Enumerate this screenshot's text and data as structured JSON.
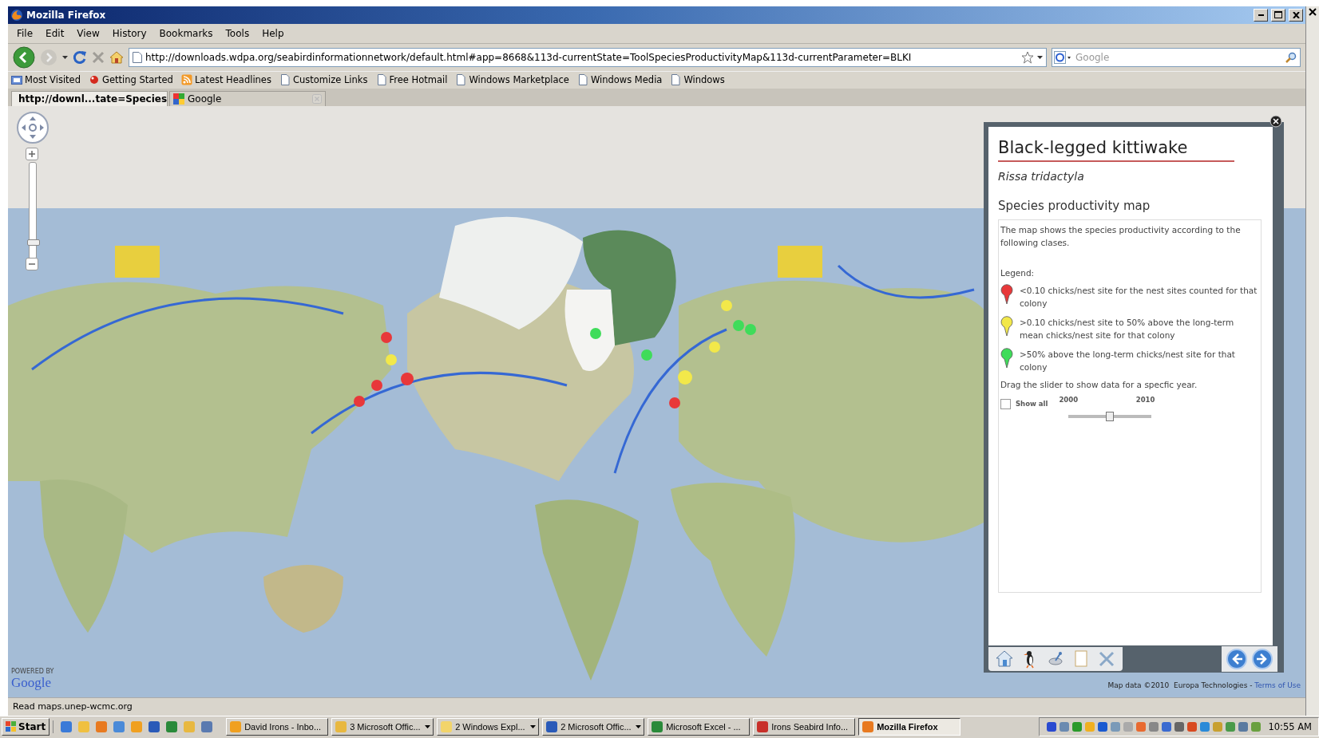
{
  "window": {
    "title": "Mozilla Firefox"
  },
  "menu": [
    "File",
    "Edit",
    "View",
    "History",
    "Bookmarks",
    "Tools",
    "Help"
  ],
  "address": {
    "url": "http://downloads.wdpa.org/seabirdinformationnetwork/default.html#app=8668&113d-currentState=ToolSpeciesProductivityMap&113d-currentParameter=BLKI"
  },
  "search": {
    "placeholder": "Google"
  },
  "bookmarks": [
    {
      "label": "Most Visited",
      "kind": "folder"
    },
    {
      "label": "Getting Started",
      "kind": "start"
    },
    {
      "label": "Latest Headlines",
      "kind": "feed"
    },
    {
      "label": "Customize Links",
      "kind": "page"
    },
    {
      "label": "Free Hotmail",
      "kind": "page"
    },
    {
      "label": "Windows Marketplace",
      "kind": "page"
    },
    {
      "label": "Windows Media",
      "kind": "page"
    },
    {
      "label": "Windows",
      "kind": "page"
    }
  ],
  "tabs": [
    {
      "label": "http://downl...tate=Species",
      "selected": true
    },
    {
      "label": "Google",
      "selected": false
    }
  ],
  "map": {
    "kind": "picture",
    "zoom": {
      "level": 0.15
    },
    "logo_caption": "POWERED BY",
    "logo": "Google",
    "attribution": "Map data ©2010  Europa Technologies - ",
    "terms_link": "Terms of Use"
  },
  "info_panel": {
    "title": "Black-legged kittiwake",
    "scientific_name": "Rissa tridactyla",
    "section": "Species productivity map",
    "description": "The map shows the species productivity according to the following clases.",
    "legend_label": "Legend:",
    "legend": [
      {
        "color": "#e8383a",
        "text": "<0.10 chicks/nest site for the nest sites counted for that colony"
      },
      {
        "color": "#f2e84a",
        "text": ">0.10 chicks/nest site to 50% above the long-term mean chicks/nest site for that colony"
      },
      {
        "color": "#3fdc5a",
        "text": ">50% above the long-term chicks/nest site for that colony"
      }
    ],
    "instruction": "Drag the slider to show data for a specfic year.",
    "show_all": {
      "label": "Show all",
      "checked": false
    },
    "slider": {
      "start": "2000",
      "end": "2010",
      "level": 0.5
    }
  },
  "status_bar": "Read maps.unep-wcmc.org",
  "taskbar": {
    "start": "Start",
    "tasks": [
      {
        "label": "David Irons - Inbo...",
        "kind": "mail",
        "grouped": false,
        "selected": false
      },
      {
        "label": "3 Microsoft Offic...",
        "kind": "office",
        "grouped": true,
        "selected": false
      },
      {
        "label": "2 Windows Expl...",
        "kind": "folder",
        "grouped": true,
        "selected": false
      },
      {
        "label": "2 Microsoft Offic...",
        "kind": "word",
        "grouped": true,
        "selected": false
      },
      {
        "label": "Microsoft Excel - ...",
        "kind": "excel",
        "grouped": false,
        "selected": false
      },
      {
        "label": "Irons Seabird Info...",
        "kind": "pdf",
        "grouped": false,
        "selected": false
      },
      {
        "label": "Mozilla Firefox",
        "kind": "browser",
        "grouped": false,
        "selected": true
      }
    ],
    "clock": "10:55 AM"
  }
}
